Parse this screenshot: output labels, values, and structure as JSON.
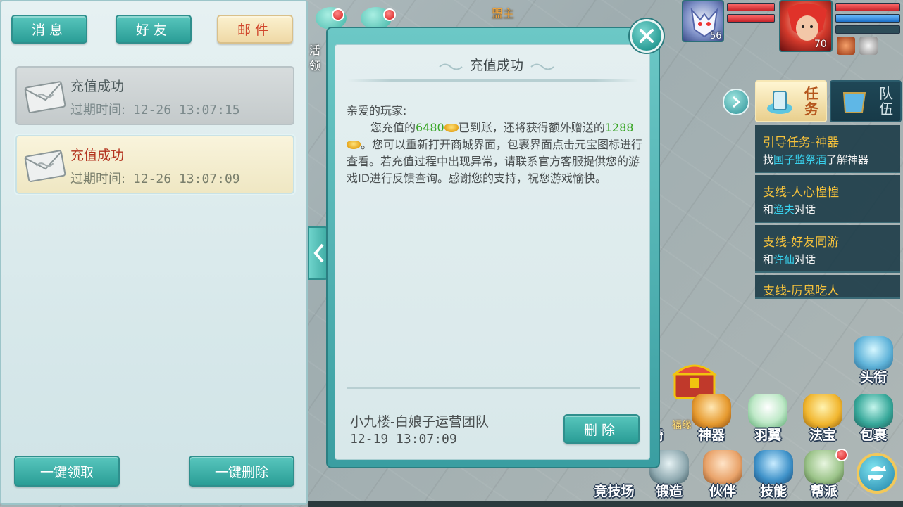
{
  "left_panel": {
    "tabs": [
      {
        "label": "消息"
      },
      {
        "label": "好友"
      },
      {
        "label": "邮件"
      }
    ],
    "mails": [
      {
        "title": "充值成功",
        "expire_label": "过期时间:",
        "expire_time": "12-26 13:07:15"
      },
      {
        "title": "充值成功",
        "expire_label": "过期时间:",
        "expire_time": "12-26 13:07:09"
      }
    ],
    "claim_all_label": "一键领取",
    "delete_all_label": "一键删除"
  },
  "detail": {
    "title": "充值成功",
    "greeting": "亲爱的玩家:",
    "body_prefix": "您充值的",
    "amount": "6480",
    "body_middle": "已到账，还将获得额外赠送的",
    "bonus": "1288",
    "body_rest": "。您可以重新打开商城界面，包裹界面点击元宝图标进行查看。若充值过程中出现异常，请联系官方客服提供您的游戏ID进行反馈查询。感谢您的支持，祝您游戏愉快。",
    "sender": "小九楼-白娘子运营团队",
    "date": "12-19 13:07:09",
    "delete_label": "删除"
  },
  "hud": {
    "top_title": "盟主",
    "left_text_1": "活",
    "left_text_2": "领",
    "pet_level": "56",
    "player_level": "70"
  },
  "tasks": {
    "quest_tab": "任务",
    "team_tab": "队伍",
    "items": [
      {
        "title": "引导任务-神器",
        "desc_prefix": "找",
        "desc_highlight": "国子监祭酒",
        "desc_suffix": "了解神器"
      },
      {
        "title": "支线-人心惶惶",
        "desc_prefix": "和",
        "desc_highlight": "渔夫",
        "desc_suffix": "对话"
      },
      {
        "title": "支线-好友同游",
        "desc_prefix": "和",
        "desc_highlight": "许仙",
        "desc_suffix": "对话"
      },
      {
        "title": "支线-厉鬼吃人",
        "desc_prefix": "",
        "desc_highlight": "",
        "desc_suffix": ""
      }
    ]
  },
  "features": {
    "row1": [
      "骑",
      "神器",
      "羽翼",
      "法宝",
      "包裹"
    ],
    "row2": [
      "竞技场",
      "锻造",
      "伙伴",
      "技能",
      "帮派"
    ],
    "top": "头衔",
    "fuyuan": "福缘"
  }
}
